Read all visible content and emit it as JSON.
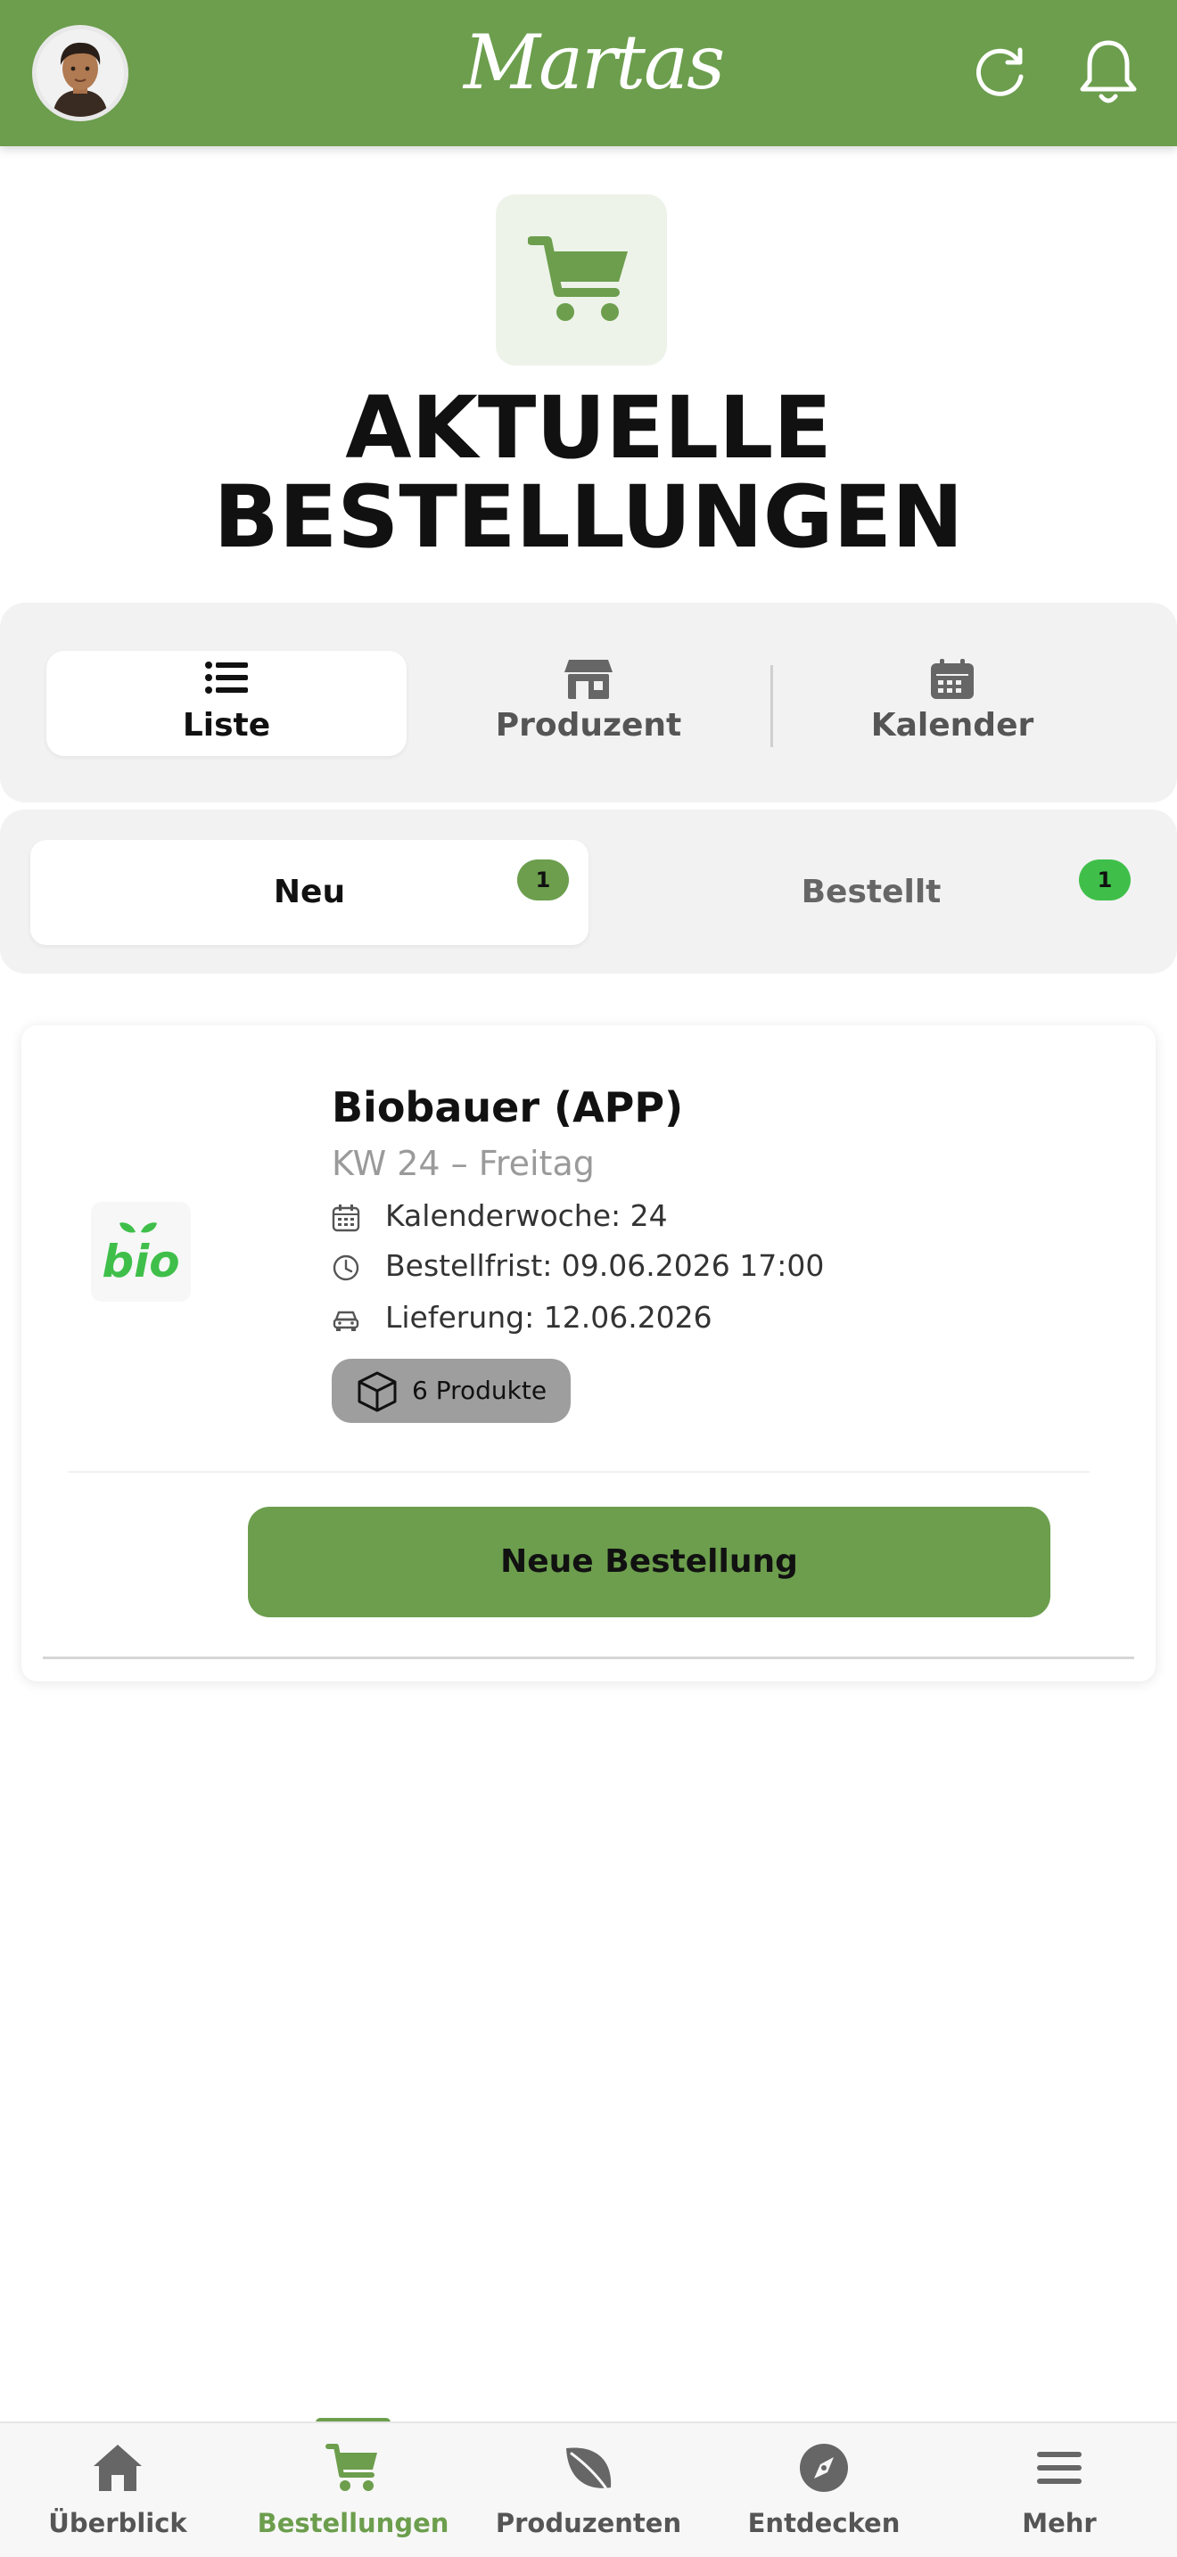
{
  "header": {
    "logo_text": "Martas",
    "avatar_icon": "user-avatar",
    "refresh_icon": "refresh-icon",
    "bell_icon": "bell-icon"
  },
  "hero": {
    "icon": "cart-icon",
    "title_line1": "AKTUELLE",
    "title_line2": "BESTELLUNGEN"
  },
  "view_tabs": [
    {
      "label": "Liste",
      "icon": "list-icon",
      "active": true
    },
    {
      "label": "Produzent",
      "icon": "store-icon",
      "active": false
    },
    {
      "label": "Kalender",
      "icon": "calendar-icon",
      "active": false
    }
  ],
  "status_tabs": [
    {
      "label": "Neu",
      "count": "1",
      "active": true,
      "badge_color": "#6c9e4d"
    },
    {
      "label": "Bestellt",
      "count": "1",
      "active": false,
      "badge_color": "#3fbf4a"
    }
  ],
  "order": {
    "producer_name": "Biobauer (APP)",
    "producer_logo_text": "bio",
    "subtitle": "KW 24 – Freitag",
    "details": [
      {
        "icon": "calendar-icon",
        "text": "Kalenderwoche: 24"
      },
      {
        "icon": "clock-icon",
        "text": "Bestellfrist: 09.06.2026 17:00"
      },
      {
        "icon": "car-icon",
        "text": "Lieferung: 12.06.2026"
      }
    ],
    "products_badge": "6 Produkte",
    "action_label": "Neue Bestellung"
  },
  "bottom_nav": [
    {
      "label": "Überblick",
      "icon": "home-icon",
      "active": false
    },
    {
      "label": "Bestellungen",
      "icon": "cart-icon",
      "active": true
    },
    {
      "label": "Produzenten",
      "icon": "leaf-icon",
      "active": false
    },
    {
      "label": "Entdecken",
      "icon": "compass-icon",
      "active": false
    },
    {
      "label": "Mehr",
      "icon": "menu-icon",
      "active": false
    }
  ],
  "colors": {
    "brand_green": "#6c9e4d",
    "badge_green_bright": "#3fbf4a",
    "panel_gray": "#f2f2f2"
  }
}
